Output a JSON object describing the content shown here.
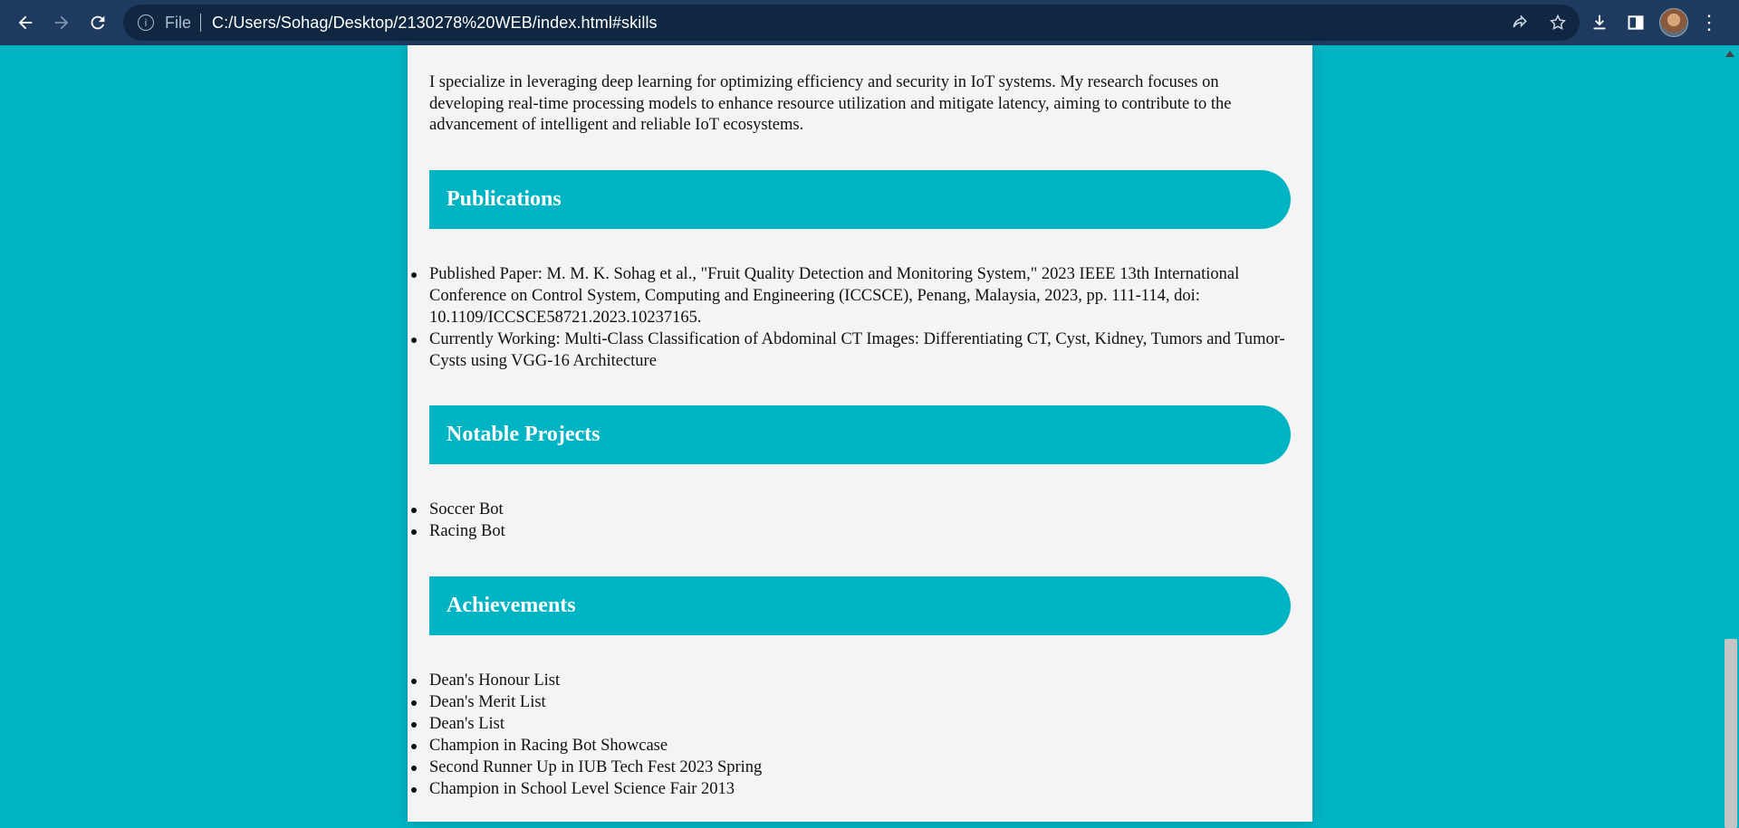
{
  "browser": {
    "url_scheme_label": "File",
    "url": "C:/Users/Sohag/Desktop/2130278%20WEB/index.html#skills",
    "icons": {
      "back": "arrow-left-icon",
      "forward": "arrow-right-icon",
      "reload": "reload-icon",
      "info": "info-icon",
      "share": "share-icon",
      "bookmark": "star-icon",
      "download": "download-icon",
      "sidepanel": "side-panel-icon",
      "menu": "kebab-menu-icon"
    }
  },
  "page": {
    "intro": "I specialize in leveraging deep learning for optimizing efficiency and security in IoT systems. My research focuses on developing real-time processing models to enhance resource utilization and mitigate latency, aiming to contribute to the advancement of intelligent and reliable IoT ecosystems.",
    "sections": [
      {
        "title": "Publications",
        "items": [
          "Published Paper: M. M. K. Sohag et al., \"Fruit Quality Detection and Monitoring System,\" 2023 IEEE 13th International Conference on Control System, Computing and Engineering (ICCSCE), Penang, Malaysia, 2023, pp. 111-114, doi: 10.1109/ICCSCE58721.2023.10237165.",
          "Currently Working: Multi-Class Classification of Abdominal CT Images: Differentiating CT, Cyst, Kidney, Tumors and Tumor-Cysts using VGG-16 Architecture"
        ]
      },
      {
        "title": "Notable Projects",
        "items": [
          "Soccer Bot",
          "Racing Bot"
        ]
      },
      {
        "title": "Achievements",
        "items": [
          "Dean's Honour List",
          "Dean's Merit List",
          "Dean's List",
          "Champion in Racing Bot Showcase",
          "Second Runner Up in IUB Tech Fest 2023 Spring",
          "Champion in School Level Science Fair 2013"
        ]
      }
    ]
  },
  "colors": {
    "accent": "#00b4c4",
    "card": "#f4f4f4",
    "chrome": "#1e3a5f"
  }
}
